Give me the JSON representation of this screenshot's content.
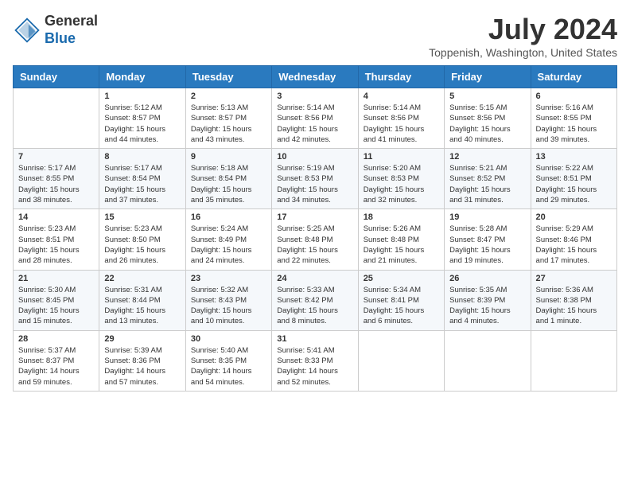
{
  "header": {
    "logo_general": "General",
    "logo_blue": "Blue",
    "month_title": "July 2024",
    "location": "Toppenish, Washington, United States"
  },
  "days_of_week": [
    "Sunday",
    "Monday",
    "Tuesday",
    "Wednesday",
    "Thursday",
    "Friday",
    "Saturday"
  ],
  "weeks": [
    [
      {
        "day": "",
        "content": ""
      },
      {
        "day": "1",
        "content": "Sunrise: 5:12 AM\nSunset: 8:57 PM\nDaylight: 15 hours\nand 44 minutes."
      },
      {
        "day": "2",
        "content": "Sunrise: 5:13 AM\nSunset: 8:57 PM\nDaylight: 15 hours\nand 43 minutes."
      },
      {
        "day": "3",
        "content": "Sunrise: 5:14 AM\nSunset: 8:56 PM\nDaylight: 15 hours\nand 42 minutes."
      },
      {
        "day": "4",
        "content": "Sunrise: 5:14 AM\nSunset: 8:56 PM\nDaylight: 15 hours\nand 41 minutes."
      },
      {
        "day": "5",
        "content": "Sunrise: 5:15 AM\nSunset: 8:56 PM\nDaylight: 15 hours\nand 40 minutes."
      },
      {
        "day": "6",
        "content": "Sunrise: 5:16 AM\nSunset: 8:55 PM\nDaylight: 15 hours\nand 39 minutes."
      }
    ],
    [
      {
        "day": "7",
        "content": "Sunrise: 5:17 AM\nSunset: 8:55 PM\nDaylight: 15 hours\nand 38 minutes."
      },
      {
        "day": "8",
        "content": "Sunrise: 5:17 AM\nSunset: 8:54 PM\nDaylight: 15 hours\nand 37 minutes."
      },
      {
        "day": "9",
        "content": "Sunrise: 5:18 AM\nSunset: 8:54 PM\nDaylight: 15 hours\nand 35 minutes."
      },
      {
        "day": "10",
        "content": "Sunrise: 5:19 AM\nSunset: 8:53 PM\nDaylight: 15 hours\nand 34 minutes."
      },
      {
        "day": "11",
        "content": "Sunrise: 5:20 AM\nSunset: 8:53 PM\nDaylight: 15 hours\nand 32 minutes."
      },
      {
        "day": "12",
        "content": "Sunrise: 5:21 AM\nSunset: 8:52 PM\nDaylight: 15 hours\nand 31 minutes."
      },
      {
        "day": "13",
        "content": "Sunrise: 5:22 AM\nSunset: 8:51 PM\nDaylight: 15 hours\nand 29 minutes."
      }
    ],
    [
      {
        "day": "14",
        "content": "Sunrise: 5:23 AM\nSunset: 8:51 PM\nDaylight: 15 hours\nand 28 minutes."
      },
      {
        "day": "15",
        "content": "Sunrise: 5:23 AM\nSunset: 8:50 PM\nDaylight: 15 hours\nand 26 minutes."
      },
      {
        "day": "16",
        "content": "Sunrise: 5:24 AM\nSunset: 8:49 PM\nDaylight: 15 hours\nand 24 minutes."
      },
      {
        "day": "17",
        "content": "Sunrise: 5:25 AM\nSunset: 8:48 PM\nDaylight: 15 hours\nand 22 minutes."
      },
      {
        "day": "18",
        "content": "Sunrise: 5:26 AM\nSunset: 8:48 PM\nDaylight: 15 hours\nand 21 minutes."
      },
      {
        "day": "19",
        "content": "Sunrise: 5:28 AM\nSunset: 8:47 PM\nDaylight: 15 hours\nand 19 minutes."
      },
      {
        "day": "20",
        "content": "Sunrise: 5:29 AM\nSunset: 8:46 PM\nDaylight: 15 hours\nand 17 minutes."
      }
    ],
    [
      {
        "day": "21",
        "content": "Sunrise: 5:30 AM\nSunset: 8:45 PM\nDaylight: 15 hours\nand 15 minutes."
      },
      {
        "day": "22",
        "content": "Sunrise: 5:31 AM\nSunset: 8:44 PM\nDaylight: 15 hours\nand 13 minutes."
      },
      {
        "day": "23",
        "content": "Sunrise: 5:32 AM\nSunset: 8:43 PM\nDaylight: 15 hours\nand 10 minutes."
      },
      {
        "day": "24",
        "content": "Sunrise: 5:33 AM\nSunset: 8:42 PM\nDaylight: 15 hours\nand 8 minutes."
      },
      {
        "day": "25",
        "content": "Sunrise: 5:34 AM\nSunset: 8:41 PM\nDaylight: 15 hours\nand 6 minutes."
      },
      {
        "day": "26",
        "content": "Sunrise: 5:35 AM\nSunset: 8:39 PM\nDaylight: 15 hours\nand 4 minutes."
      },
      {
        "day": "27",
        "content": "Sunrise: 5:36 AM\nSunset: 8:38 PM\nDaylight: 15 hours\nand 1 minute."
      }
    ],
    [
      {
        "day": "28",
        "content": "Sunrise: 5:37 AM\nSunset: 8:37 PM\nDaylight: 14 hours\nand 59 minutes."
      },
      {
        "day": "29",
        "content": "Sunrise: 5:39 AM\nSunset: 8:36 PM\nDaylight: 14 hours\nand 57 minutes."
      },
      {
        "day": "30",
        "content": "Sunrise: 5:40 AM\nSunset: 8:35 PM\nDaylight: 14 hours\nand 54 minutes."
      },
      {
        "day": "31",
        "content": "Sunrise: 5:41 AM\nSunset: 8:33 PM\nDaylight: 14 hours\nand 52 minutes."
      },
      {
        "day": "",
        "content": ""
      },
      {
        "day": "",
        "content": ""
      },
      {
        "day": "",
        "content": ""
      }
    ]
  ]
}
